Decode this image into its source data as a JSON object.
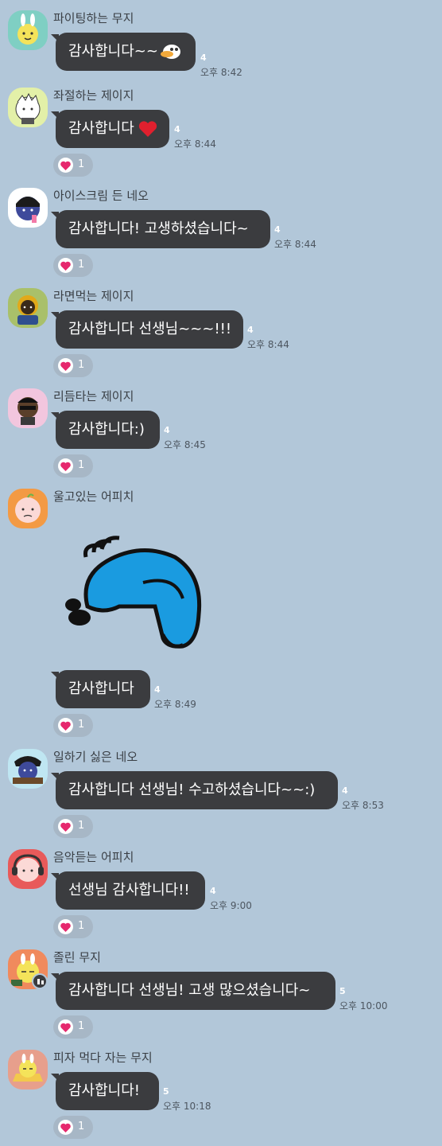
{
  "messages": [
    {
      "sender": "파이팅하는 무지",
      "text": "감사합니다~~",
      "emoji": "duck-emoji",
      "unread": "4",
      "time": "오후 8:42",
      "reaction": null,
      "avatar_color": "#7fcfc3"
    },
    {
      "sender": "좌절하는 제이지",
      "text": "감사합니다",
      "emoji": "red-heart",
      "unread": "4",
      "time": "오후 8:44",
      "reaction": "1",
      "avatar_color": "#e3f0a8"
    },
    {
      "sender": "아이스크림 든 네오",
      "text": "감사합니다! 고생하셨습니다~",
      "unread": "4",
      "time": "오후 8:44",
      "reaction": "1",
      "avatar_color": "#ffffff"
    },
    {
      "sender": "라면먹는 제이지",
      "text": "감사합니다 선생님~~~!!!",
      "unread": "4",
      "time": "오후 8:44",
      "reaction": "1",
      "avatar_color": "#a9c06a"
    },
    {
      "sender": "리듬타는 제이지",
      "text": "감사합니다:)",
      "unread": "4",
      "time": "오후 8:45",
      "reaction": "1",
      "avatar_color": "#f2c6de"
    },
    {
      "sender": "울고있는 어피치",
      "text": "감사합니다",
      "sticker": "bowing-blue-character",
      "unread": "4",
      "time": "오후 8:49",
      "reaction": "1",
      "avatar_color": "#f39a44"
    },
    {
      "sender": "일하기 싫은 네오",
      "text": "감사합니다 선생님! 수고하셨습니다~~:)",
      "unread": "4",
      "time": "오후 8:53",
      "reaction": "1",
      "avatar_color": "#bfe6f2"
    },
    {
      "sender": "음악듣는 어피치",
      "text": "선생님 감사합니다!!",
      "unread": "4",
      "time": "오후 9:00",
      "reaction": "1",
      "avatar_color": "#e85a5a"
    },
    {
      "sender": "졸린 무지",
      "text": "감사합니다 선생님! 고생 많으셨습니다~",
      "unread": "5",
      "time": "오후 10:00",
      "reaction": "1",
      "avatar_color": "#f08a5d"
    },
    {
      "sender": "피자 먹다 자는 무지",
      "text": "감사합니다!",
      "unread": "5",
      "time": "오후 10:18",
      "reaction": "1",
      "avatar_color": "#e79f8c"
    }
  ],
  "colors": {
    "background": "#b2c7d9",
    "bubble": "#3b3c3f",
    "reaction_pill": "#a7b7c6",
    "heart": "#e6286e"
  }
}
